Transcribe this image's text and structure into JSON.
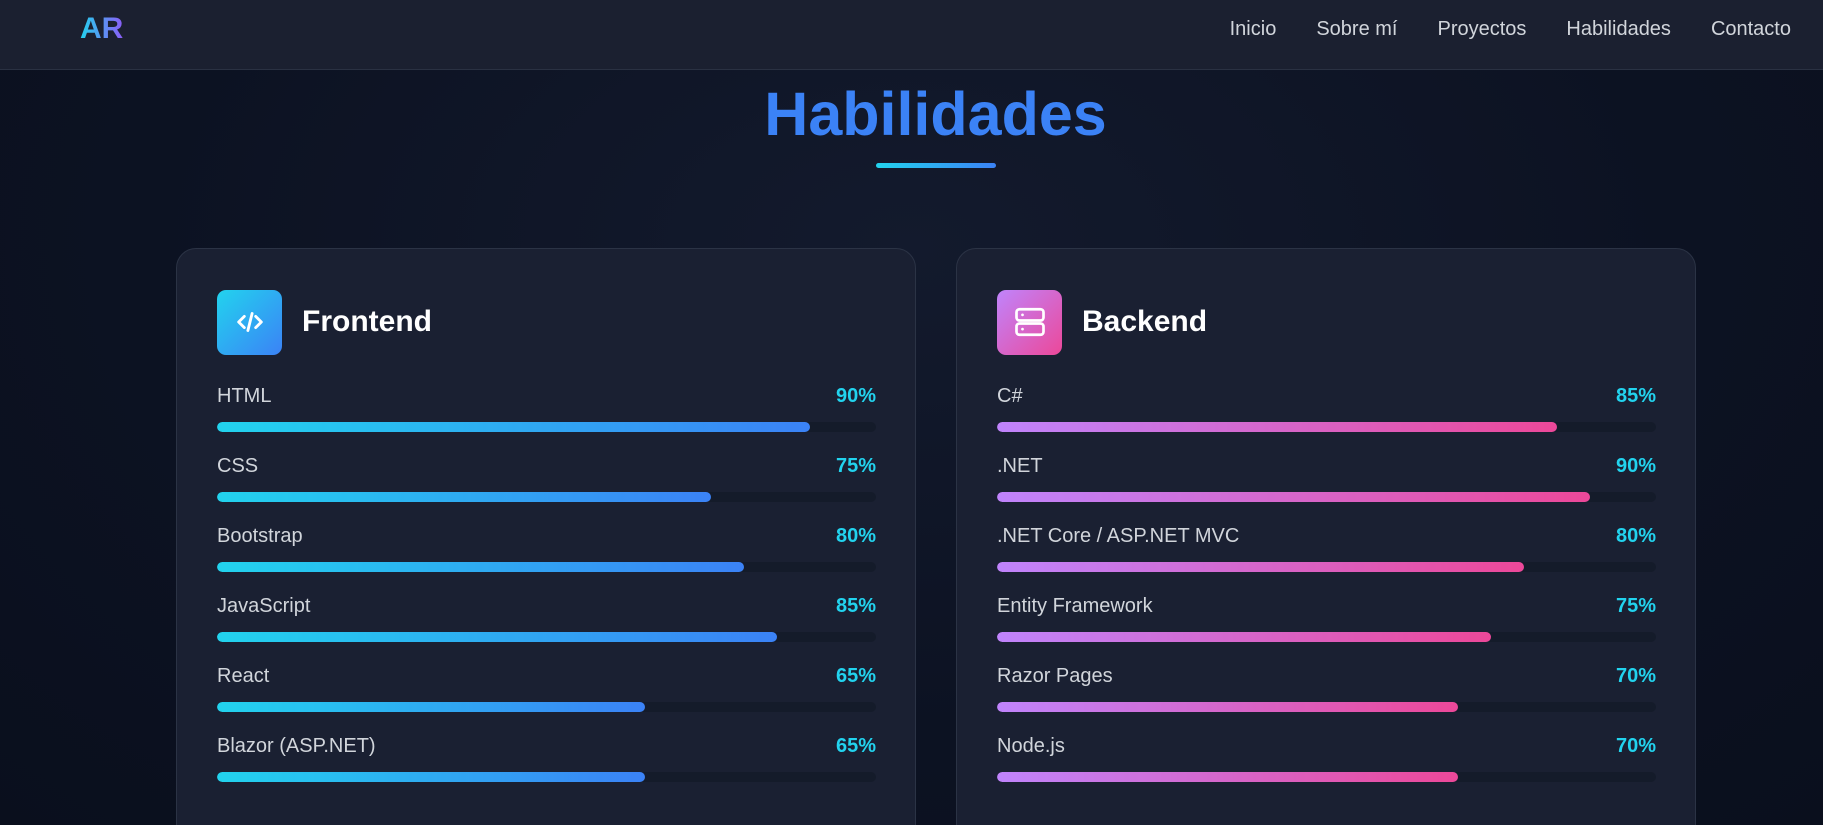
{
  "navbar": {
    "logo": "AR",
    "links": [
      "Inicio",
      "Sobre mí",
      "Proyectos",
      "Habilidades",
      "Contacto"
    ]
  },
  "section": {
    "title": "Habilidades"
  },
  "colors": {
    "background": "#0c1222",
    "card": "#1a2032",
    "accent_cyan": "#22d3ee",
    "accent_blue": "#3b82f6",
    "accent_purple": "#c084fc",
    "accent_pink": "#ec4899"
  },
  "cards": [
    {
      "title": "Frontend",
      "icon": "code-icon",
      "skills": [
        {
          "name": "HTML",
          "percent_label": "90%",
          "level": 90
        },
        {
          "name": "CSS",
          "percent_label": "75%",
          "level": 75
        },
        {
          "name": "Bootstrap",
          "percent_label": "80%",
          "level": 80
        },
        {
          "name": "JavaScript",
          "percent_label": "85%",
          "level": 85
        },
        {
          "name": "React",
          "percent_label": "65%",
          "level": 65
        },
        {
          "name": "Blazor (ASP.NET)",
          "percent_label": "65%",
          "level": 65
        }
      ]
    },
    {
      "title": "Backend",
      "icon": "server-icon",
      "skills": [
        {
          "name": "C#",
          "percent_label": "85%",
          "level": 85
        },
        {
          "name": ".NET",
          "percent_label": "90%",
          "level": 90
        },
        {
          "name": ".NET Core / ASP.NET MVC",
          "percent_label": "80%",
          "level": 80
        },
        {
          "name": "Entity Framework",
          "percent_label": "75%",
          "level": 75
        },
        {
          "name": "Razor Pages",
          "percent_label": "70%",
          "level": 70
        },
        {
          "name": "Node.js",
          "percent_label": "70%",
          "level": 70
        }
      ]
    }
  ]
}
